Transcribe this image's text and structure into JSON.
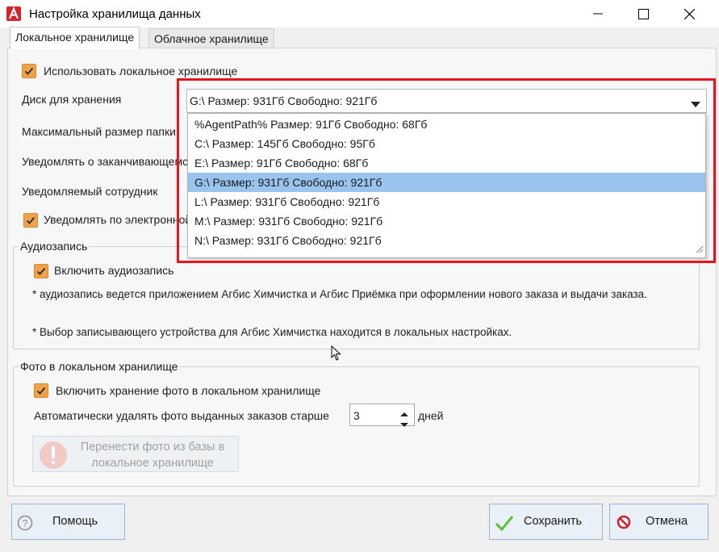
{
  "window": {
    "title": "Настройка хранилища данных"
  },
  "tabs": [
    {
      "label": "Локальное хранилище"
    },
    {
      "label": "Облачное хранилище"
    }
  ],
  "local": {
    "use_local_label": "Использовать локальное хранилище",
    "disk_label": "Диск для хранения",
    "max_size_label": "Максимальный размер папки",
    "notify_label": "Уведомлять о заканчивающемся",
    "employee_label": "Уведомляемый сотрудник",
    "email_notify_label": "Уведомлять по электронной",
    "disk_selected": "G:\\ Размер: 931Гб Свободно: 921Гб",
    "disk_options": [
      "%AgentPath% Размер: 91Гб Свободно: 68Гб",
      "C:\\ Размер: 145Гб Свободно: 95Гб",
      "E:\\ Размер: 91Гб Свободно: 68Гб",
      "G:\\ Размер: 931Гб Свободно: 921Гб",
      "L:\\ Размер: 931Гб Свободно: 921Гб",
      "M:\\ Размер: 931Гб Свободно: 921Гб",
      "N:\\ Размер: 931Гб Свободно: 921Гб"
    ],
    "selected_index": 3
  },
  "audio": {
    "group_title": "Аудиозапись",
    "enable_label": "Включить аудиозапись",
    "note1": "* аудиозапись ведется приложением Агбис Химчистка и Агбис Приёмка при оформлении нового заказа и выдачи заказа.",
    "note2": "* Выбор записывающего устройства для Агбис Химчистка находится в локальных настройках."
  },
  "photo": {
    "group_title": "Фото в локальном хранилище",
    "enable_label": "Включить хранение фото в локальном хранилище",
    "autodelete_label": "Автоматически удалять фото выданных заказов старше",
    "days_value": "3",
    "days_unit": "дней",
    "move_button_line1": "Перенести фото из базы в",
    "move_button_line2": "локальное хранилище"
  },
  "footer": {
    "help_label": "Помощь",
    "save_label": "Сохранить",
    "cancel_label": "Отмена"
  },
  "colors": {
    "checkbox": "#f0a24a",
    "selection": "#99c4ee",
    "highlight_frame": "#e8141c",
    "save_check": "#5bbf3a",
    "cancel_icon": "#d0202a"
  }
}
